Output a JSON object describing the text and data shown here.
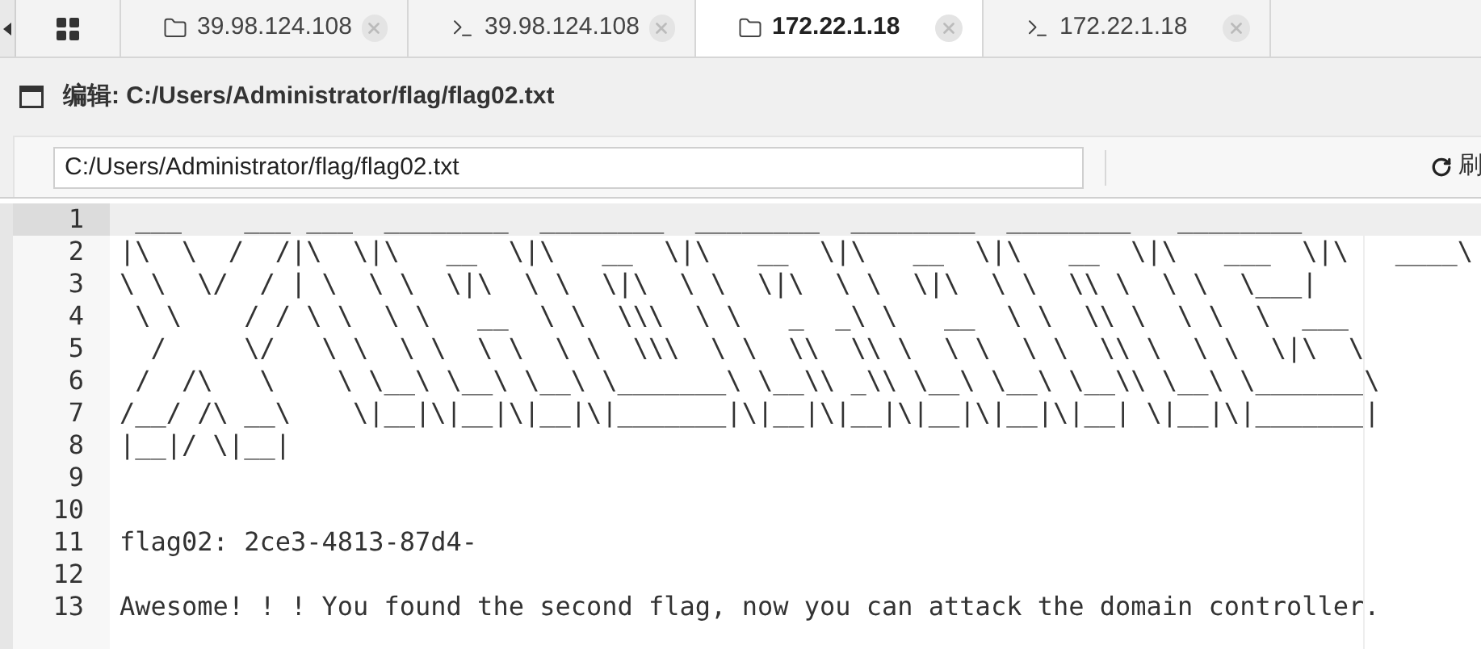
{
  "tabs": [
    {
      "kind": "home",
      "selected": false
    },
    {
      "kind": "folder",
      "label": "39.98.124.108",
      "selected": false
    },
    {
      "kind": "terminal",
      "label": "39.98.124.108",
      "selected": false
    },
    {
      "kind": "folder",
      "label": "172.22.1.18",
      "selected": true
    },
    {
      "kind": "terminal",
      "label": "172.22.1.18",
      "selected": false
    }
  ],
  "editor_title": "编辑: C:/Users/Administrator/flag/flag02.txt",
  "path_field": {
    "value": "C:/Users/Administrator/flag/flag02.txt"
  },
  "refresh_button": {
    "label": "刷"
  },
  "editor": {
    "lines": [
      {
        "number": "1",
        "text": " ___    ___ ___  ________  ________  ________  ________  ________   ________",
        "active": true
      },
      {
        "number": "2",
        "text": "|\\  \\  /  /|\\  \\|\\   __  \\|\\   __  \\|\\   __  \\|\\   __  \\|\\   __  \\|\\   ___  \\|\\   ____\\",
        "active": false
      },
      {
        "number": "3",
        "text": "\\ \\  \\/  / | \\  \\ \\  \\|\\  \\ \\  \\|\\  \\ \\  \\|\\  \\ \\  \\|\\  \\ \\  \\\\ \\  \\ \\  \\___|",
        "active": false
      },
      {
        "number": "4",
        "text": " \\ \\    / / \\ \\  \\ \\   __  \\ \\  \\\\\\  \\ \\   _  _\\ \\   __  \\ \\  \\\\ \\  \\ \\  \\  ___",
        "active": false
      },
      {
        "number": "5",
        "text": "  /     \\/   \\ \\  \\ \\  \\ \\  \\ \\  \\\\\\  \\ \\  \\\\  \\\\ \\  \\ \\  \\ \\  \\\\ \\  \\ \\  \\|\\  \\",
        "active": false
      },
      {
        "number": "6",
        "text": " /  /\\   \\    \\ \\__\\ \\__\\ \\__\\ \\_______\\ \\__\\\\ _\\\\ \\__\\ \\__\\ \\__\\\\ \\__\\ \\_______\\",
        "active": false
      },
      {
        "number": "7",
        "text": "/__/ /\\ __\\    \\|__|\\|__|\\|__|\\|_______|\\|__|\\|__|\\|__|\\|__|\\|__| \\|__|\\|_______|",
        "active": false
      },
      {
        "number": "8",
        "text": "|__|/ \\|__|",
        "active": false
      },
      {
        "number": "9",
        "active": false
      },
      {
        "number": "10",
        "active": false
      },
      {
        "number": "11",
        "text": "flag02: 2ce3-4813-87d4-",
        "active": false
      },
      {
        "number": "12",
        "active": false
      },
      {
        "number": "13",
        "text": "Awesome! ! ! You found the second flag, now you can attack the domain controller.",
        "active": false
      }
    ]
  }
}
